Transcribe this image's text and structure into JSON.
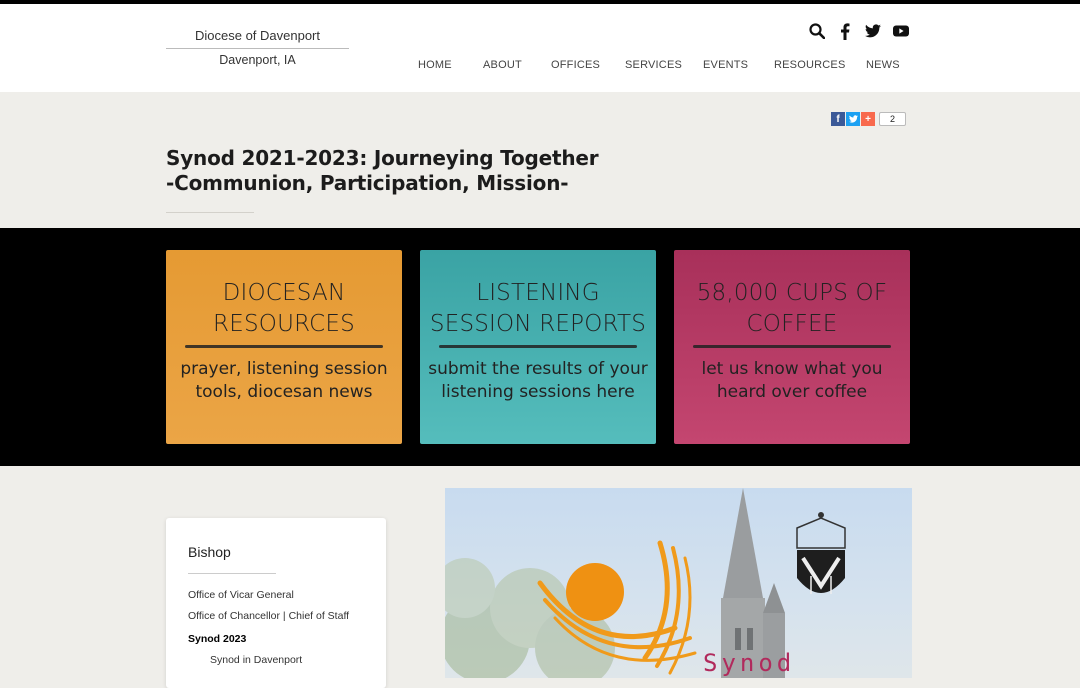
{
  "site": {
    "name": "Diocese of Davenport",
    "location": "Davenport, IA"
  },
  "header_icons": [
    "search-icon",
    "facebook-icon",
    "twitter-icon",
    "youtube-icon"
  ],
  "nav": {
    "items": [
      "HOME",
      "ABOUT",
      "OFFICES",
      "SERVICES",
      "EVENTS",
      "RESOURCES",
      "NEWS"
    ]
  },
  "share": {
    "count": "2"
  },
  "page": {
    "title_line1": "Synod 2021-2023: Journeying Together",
    "title_line2": "-Communion, Participation, Mission-"
  },
  "cards": [
    {
      "heading_line1": "DIOCESAN",
      "heading_line2": "RESOURCES",
      "sub_line1": "prayer, listening session",
      "sub_line2": "tools, diocesan news",
      "color": "#e8a03d"
    },
    {
      "heading_line1": "LISTENING",
      "heading_line2": "SESSION REPORTS",
      "sub_line1": "submit the results of your",
      "sub_line2": "listening sessions here",
      "color": "#48b1b1"
    },
    {
      "heading_line1": "58,000 CUPS OF",
      "heading_line2": "COFFEE",
      "sub_line1": "let us know what you",
      "sub_line2": "heard over coffee",
      "color": "#b83a64"
    }
  ],
  "sidebar": {
    "title": "Bishop",
    "links": [
      "Office of Vicar General",
      "Office of Chancellor | Chief of Staff",
      "Synod 2023",
      "Synod in Davenport"
    ]
  },
  "feature": {
    "word": "Synod"
  },
  "colors": {
    "accent_black": "#000000",
    "background": "#efeeea",
    "facebook": "#3b5998",
    "twitter": "#1da1f2",
    "addthis": "#f8694d"
  }
}
